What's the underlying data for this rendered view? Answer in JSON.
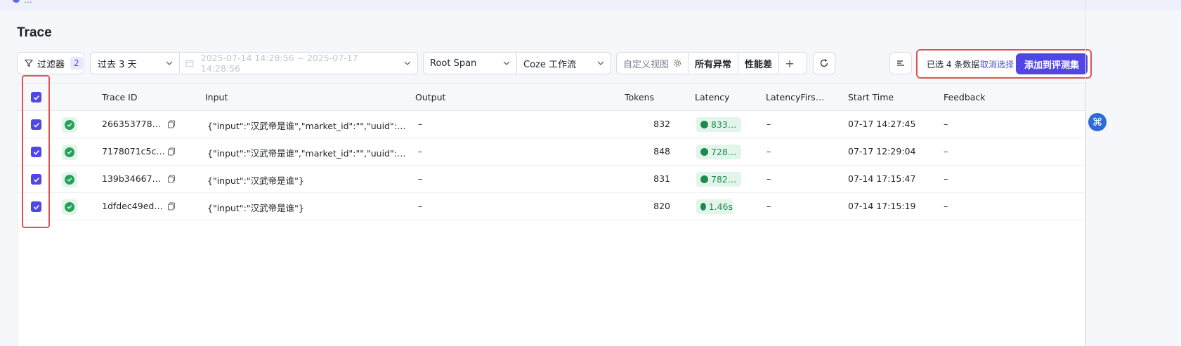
{
  "top_notice": {
    "text": "…"
  },
  "page_title": "Trace",
  "toolbar": {
    "filter_label": "过滤器",
    "filter_count": "2",
    "time_range": "过去 3 天",
    "date_range": "2025-07-14 14:28:56 ~ 2025-07-17 14:28:56",
    "span_type": "Root Span",
    "workflow": "Coze 工作流",
    "custom_view_placeholder": "自定义视图",
    "view_all_errors": "所有异常",
    "view_poor_perf": "性能差",
    "add_view": "+"
  },
  "selection": {
    "count_text": "已选 4 条数据",
    "cancel_label": "取消选择",
    "add_label": "添加到评测集"
  },
  "table": {
    "columns": [
      "Trace ID",
      "Input",
      "Output",
      "Tokens",
      "Latency",
      "LatencyFirs…",
      "Start Time",
      "Feedback"
    ],
    "rows": [
      {
        "trace_id": "266353778…",
        "input": "{\"input\":\"汉武帝是谁\",\"market_id\":\"\",\"uuid\":…",
        "output": "–",
        "tokens": "832",
        "latency": "833…",
        "latency_first": "–",
        "start_time": "07-17 14:27:45",
        "feedback": "–"
      },
      {
        "trace_id": "7178071c5c…",
        "input": "{\"input\":\"汉武帝是谁\",\"market_id\":\"\",\"uuid\":…",
        "output": "–",
        "tokens": "848",
        "latency": "728…",
        "latency_first": "–",
        "start_time": "07-17 12:29:04",
        "feedback": "–"
      },
      {
        "trace_id": "139b34667…",
        "input": "{\"input\":\"汉武帝是谁\"}",
        "output": "–",
        "tokens": "831",
        "latency": "782…",
        "latency_first": "–",
        "start_time": "07-14 17:15:47",
        "feedback": "–"
      },
      {
        "trace_id": "1dfdec49ed…",
        "input": "{\"input\":\"汉武帝是谁\"}",
        "output": "–",
        "tokens": "820",
        "latency": "1.46s",
        "latency_first": "–",
        "start_time": "07-14 17:15:19",
        "feedback": "–"
      }
    ]
  },
  "side_float_icon": "⌘",
  "colors": {
    "primary": "#4f46e5",
    "success": "#23a35a",
    "highlight": "#e05353"
  }
}
